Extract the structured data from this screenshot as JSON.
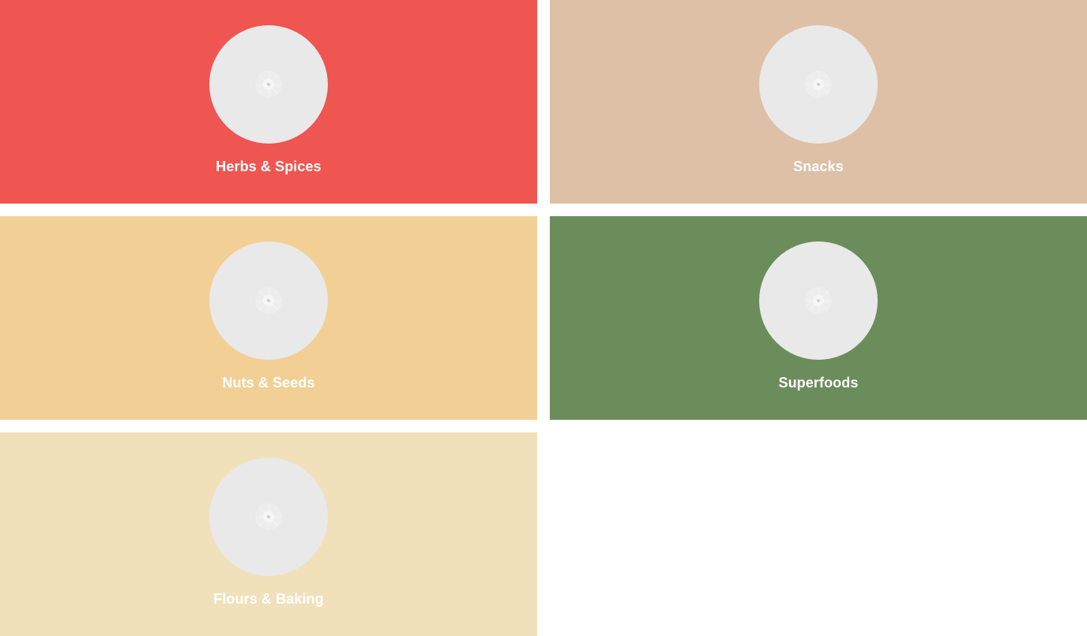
{
  "categories": [
    {
      "label": "Herbs & Spices",
      "color": "#ef5551",
      "image_icon": "image-placeholder-icon"
    },
    {
      "label": "Snacks",
      "color": "#dec0a6",
      "image_icon": "image-placeholder-icon"
    },
    {
      "label": "Nuts & Seeds",
      "color": "#f2d095",
      "image_icon": "image-placeholder-icon"
    },
    {
      "label": "Superfoods",
      "color": "#6b8d5b",
      "image_icon": "image-placeholder-icon"
    },
    {
      "label": "Flours & Baking",
      "color": "#f0e1bb",
      "image_icon": "image-placeholder-icon"
    }
  ]
}
